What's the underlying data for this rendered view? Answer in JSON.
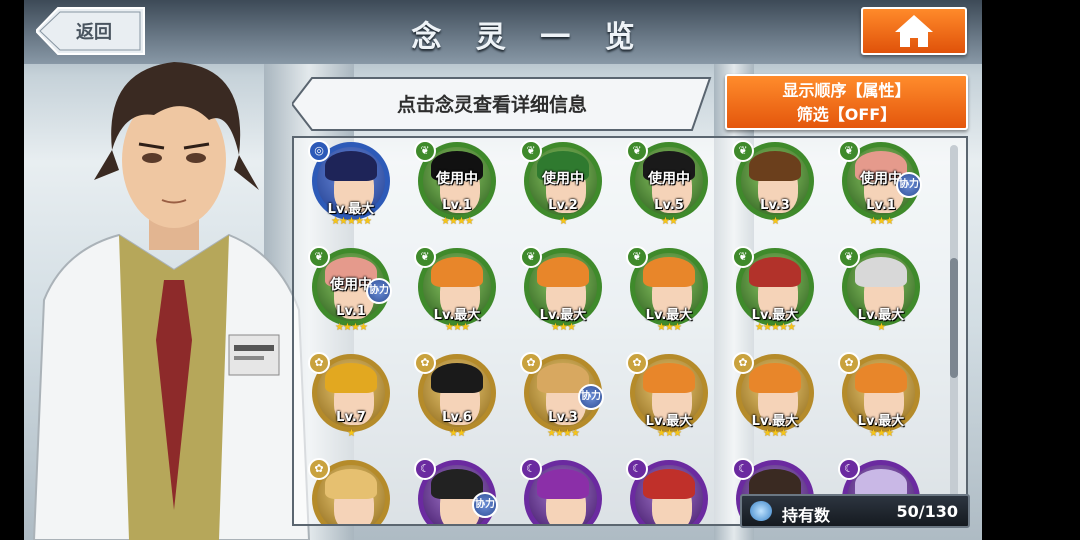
{
  "header": {
    "title": "念 灵 一 览",
    "back_label": "返回"
  },
  "instruction": "点击念灵查看详细信息",
  "sort_button": {
    "line1": "显示顺序【属性】",
    "line2": "筛选【OFF】"
  },
  "grid": {
    "cells": [
      {
        "element": "water",
        "in_use": "",
        "level": "Lv.最大",
        "stars": "★★★★★",
        "help": ""
      },
      {
        "element": "wind",
        "in_use": "使用中",
        "level": "Lv.1",
        "stars": "★★★★",
        "help": ""
      },
      {
        "element": "wind",
        "in_use": "使用中",
        "level": "Lv.2",
        "stars": "★",
        "help": ""
      },
      {
        "element": "wind",
        "in_use": "使用中",
        "level": "Lv.5",
        "stars": "★★",
        "help": ""
      },
      {
        "element": "wind",
        "in_use": "",
        "level": "Lv.3",
        "stars": "★",
        "help": ""
      },
      {
        "element": "wind",
        "in_use": "使用中",
        "level": "Lv.1",
        "stars": "★★★",
        "help": "协力"
      },
      {
        "element": "wind",
        "in_use": "使用中",
        "level": "Lv.1",
        "stars": "★★★★",
        "help": "协力"
      },
      {
        "element": "wind",
        "in_use": "",
        "level": "Lv.最大",
        "stars": "★★★",
        "help": ""
      },
      {
        "element": "wind",
        "in_use": "",
        "level": "Lv.最大",
        "stars": "★★★",
        "help": ""
      },
      {
        "element": "wind",
        "in_use": "",
        "level": "Lv.最大",
        "stars": "★★★",
        "help": ""
      },
      {
        "element": "wind",
        "in_use": "",
        "level": "Lv.最大",
        "stars": "★★★★★",
        "help": ""
      },
      {
        "element": "wind",
        "in_use": "",
        "level": "Lv.最大",
        "stars": "★",
        "help": ""
      },
      {
        "element": "light",
        "in_use": "",
        "level": "Lv.7",
        "stars": "★",
        "help": ""
      },
      {
        "element": "light",
        "in_use": "",
        "level": "Lv.6",
        "stars": "★★",
        "help": ""
      },
      {
        "element": "light",
        "in_use": "",
        "level": "Lv.3",
        "stars": "★★★★",
        "help": "协力"
      },
      {
        "element": "light",
        "in_use": "",
        "level": "Lv.最大",
        "stars": "★★★",
        "help": ""
      },
      {
        "element": "light",
        "in_use": "",
        "level": "Lv.最大",
        "stars": "★★★",
        "help": ""
      },
      {
        "element": "light",
        "in_use": "",
        "level": "Lv.最大",
        "stars": "★★★",
        "help": ""
      },
      {
        "element": "light",
        "in_use": "",
        "level": "",
        "stars": "",
        "help": ""
      },
      {
        "element": "dark",
        "in_use": "",
        "level": "",
        "stars": "",
        "help": "协力"
      },
      {
        "element": "dark",
        "in_use": "",
        "level": "",
        "stars": "",
        "help": ""
      },
      {
        "element": "dark",
        "in_use": "",
        "level": "",
        "stars": "",
        "help": ""
      },
      {
        "element": "dark",
        "in_use": "",
        "level": "",
        "stars": "",
        "help": ""
      },
      {
        "element": "dark",
        "in_use": "",
        "level": "",
        "stars": "",
        "help": ""
      }
    ]
  },
  "owned": {
    "label": "持有数",
    "value": "50/130"
  },
  "colors": {
    "accent_orange": "#e4560c",
    "water": "#2d5ab8",
    "wind": "#3f8a2b",
    "light": "#c9a23e",
    "dark": "#6b2aa0"
  },
  "icons": {
    "home": "home-icon",
    "back": "back-arrow-icon",
    "owned": "spirit-orb-icon"
  }
}
